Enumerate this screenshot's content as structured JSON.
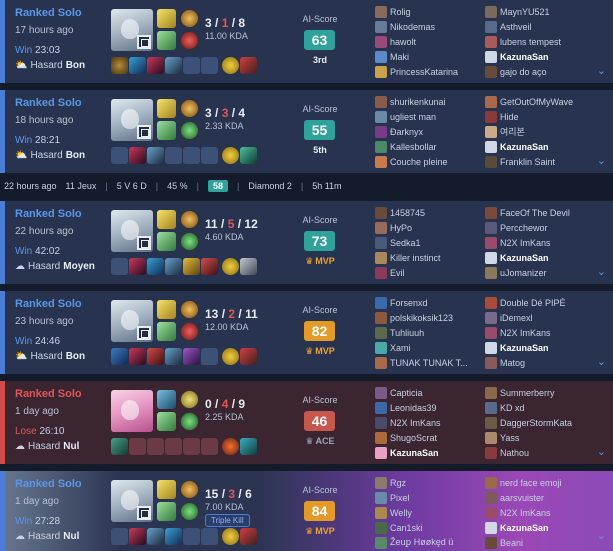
{
  "summary": {
    "time": "22 hours ago",
    "games": "11 Jeux",
    "record": "5 V 6 D",
    "winrate": "45 %",
    "avg_score": "58",
    "rank": "Diamond 2",
    "playtime": "5h 11m"
  },
  "ai_label": "AI-Score",
  "matches": [
    {
      "queue": "Ranked Solo",
      "time": "17 hours ago",
      "result": "Win",
      "duration": "23:03",
      "weather_label": "Hasard",
      "weather_value": "Bon",
      "kills": "3",
      "deaths": "1",
      "assists": "8",
      "kda": "11.00 KDA",
      "score": "63",
      "rank": "3rd",
      "team_a": [
        "Rolig",
        "Nikodemas",
        "hawolt",
        "Maki",
        "PrincessKatarina"
      ],
      "team_b": [
        "MaynYU521",
        "Asthveil",
        "lubens tempest",
        "KazunaSan",
        "gajo do aço"
      ]
    },
    {
      "queue": "Ranked Solo",
      "time": "18 hours ago",
      "result": "Win",
      "duration": "28:21",
      "weather_label": "Hasard",
      "weather_value": "Bon",
      "kills": "3",
      "deaths": "3",
      "assists": "4",
      "kda": "2.33 KDA",
      "score": "55",
      "rank": "5th",
      "team_a": [
        "shurikenkunai",
        "ugliest man",
        "Ðarknyx",
        "Kallesbollar",
        "Couche pleine"
      ],
      "team_b": [
        "GetOutOfMyWave",
        "Hide",
        "여리본",
        "KazunaSan",
        "Franklin Saint"
      ]
    },
    {
      "queue": "Ranked Solo",
      "time": "22 hours ago",
      "result": "Win",
      "duration": "42:02",
      "weather_label": "Hasard",
      "weather_value": "Moyen",
      "kills": "11",
      "deaths": "5",
      "assists": "12",
      "kda": "4.60 KDA",
      "score": "73",
      "rank": "MVP",
      "team_a": [
        "1458745",
        "HyPo",
        "Sedka1",
        "Killer instinct",
        "Evil"
      ],
      "team_b": [
        "FaceOf The Devil",
        "Percchewor",
        "N2X ImKans",
        "KazunaSan",
        "uJomanizer"
      ]
    },
    {
      "queue": "Ranked Solo",
      "time": "23 hours ago",
      "result": "Win",
      "duration": "24:46",
      "weather_label": "Hasard",
      "weather_value": "Bon",
      "kills": "13",
      "deaths": "2",
      "assists": "11",
      "kda": "12.00 KDA",
      "score": "82",
      "rank": "MVP",
      "team_a": [
        "Forsenxd",
        "polskikoksik123",
        "Tuhliuuh",
        "Xami",
        "TUNAK TUNAK T..."
      ],
      "team_b": [
        "Double Dé PIPÉ",
        "iDemexl",
        "N2X ImKans",
        "KazunaSan",
        "Matog"
      ]
    },
    {
      "queue": "Ranked Solo",
      "time": "1 day ago",
      "result": "Lose",
      "duration": "26:10",
      "weather_label": "Hasard",
      "weather_value": "Nul",
      "kills": "0",
      "deaths": "4",
      "assists": "9",
      "kda": "2.25 KDA",
      "score": "46",
      "rank": "ACE",
      "team_a": [
        "Capticia",
        "Leonidas39",
        "N2X ImKans",
        "ShugoScrat",
        "KazunaSan"
      ],
      "team_b": [
        "Summerberry",
        "KD xd",
        "DaggerStormKata",
        "Yass",
        "Nathou"
      ]
    },
    {
      "queue": "Ranked Solo",
      "time": "1 day ago",
      "result": "Win",
      "duration": "27:28",
      "weather_label": "Hasard",
      "weather_value": "Nul",
      "kills": "15",
      "deaths": "3",
      "assists": "6",
      "kda": "7.00 KDA",
      "badge": "Triple Kill",
      "score": "84",
      "rank": "MVP",
      "team_a": [
        "Rgz",
        "Pixel",
        "Welly",
        "Can1ski",
        "Žeuꝑ Høøkęd ü"
      ],
      "team_b": [
        "nerd face emoji",
        "aarsvuister",
        "N2X ImKans",
        "KazunaSan",
        "Beani"
      ]
    }
  ],
  "colors": {
    "win_accent": "#4a7dd6",
    "lose_accent": "#d24a4a",
    "score_teal": "#2fa39b",
    "score_gold": "#e49a27",
    "score_red": "#c7564c",
    "mvp_gold": "#f0a22e"
  },
  "icons": {
    "weather_good": "sun-cloud-icon",
    "weather_mid": "cloud-icon",
    "weather_bad": "cloud-icon",
    "mvp": "crown-icon",
    "ace": "crown-icon",
    "expand": "chevron-down-icon"
  }
}
